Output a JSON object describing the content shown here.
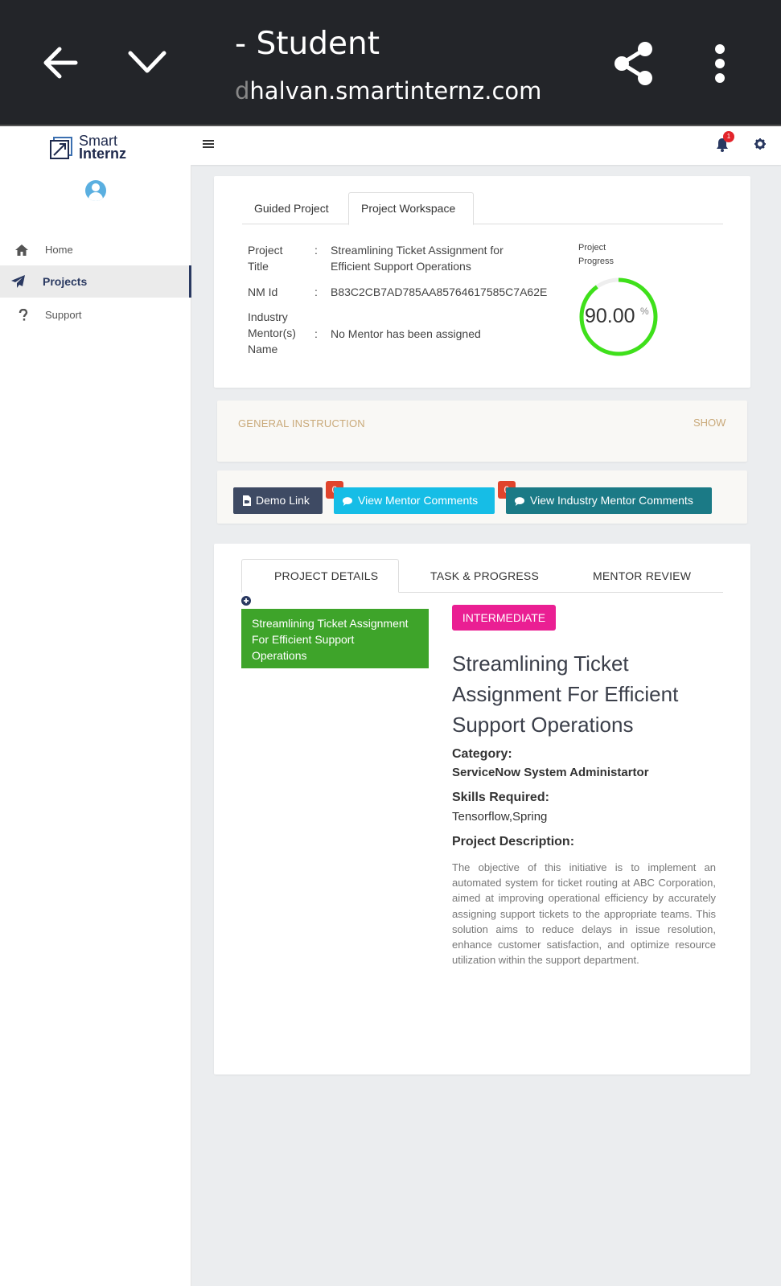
{
  "browser": {
    "title": "- Student",
    "url_faded": "d",
    "url": "halvan.smartinternz.com"
  },
  "header": {
    "logo_line1": "Smart",
    "logo_line2": "Internz",
    "notification_count": "1"
  },
  "sidebar": {
    "items": [
      {
        "label": "Home",
        "icon": "home-icon"
      },
      {
        "label": "Projects",
        "icon": "paper-plane-icon"
      },
      {
        "label": "Support",
        "icon": "question-icon"
      }
    ]
  },
  "top_tabs": [
    "Guided Project",
    "Project Workspace"
  ],
  "project_info": {
    "title_label_1": "Project",
    "title_label_2": "Title",
    "title_value_1": "Streamlining Ticket Assignment for",
    "title_value_2": "Efficient Support Operations",
    "nm_label": "NM Id",
    "nm_value": "B83C2CB7AD785AA85764617585C7A62E",
    "mentor_label_1": "Industry",
    "mentor_label_2": "Mentor(s)",
    "mentor_label_3": "Name",
    "mentor_value": "No Mentor has been assigned",
    "colon": ":"
  },
  "progress": {
    "label_1": "Project",
    "label_2": "Progress",
    "value": "90.00",
    "unit": "%",
    "fraction": 0.9
  },
  "general_instruction": {
    "title": "GENERAL INSTRUCTION",
    "toggle": "SHOW"
  },
  "actions": {
    "demo": "Demo Link",
    "mentor_comments": "View Mentor Comments",
    "mentor_comments_count": "0",
    "industry_comments": "View Industry Mentor Comments",
    "industry_comments_count": "0"
  },
  "detail_tabs": [
    "PROJECT DETAILS",
    "TASK & PROGRESS",
    "MENTOR REVIEW"
  ],
  "project_list": {
    "item_line1": "Streamlining Ticket Assignment",
    "item_line2": "For Efficient Support",
    "item_line3": "Operations"
  },
  "project_detail": {
    "level": "INTERMEDIATE",
    "heading_1": "Streamlining Ticket",
    "heading_2": "Assignment For Efficient",
    "heading_3": "Support Operations",
    "category_label": "Category:",
    "category_value": "ServiceNow System Administartor",
    "skills_label": "Skills Required:",
    "skills_value": "Tensorflow,Spring",
    "description_label": "Project Description:",
    "description": "The objective of this initiative is to implement an automated system for ticket routing at ABC Corporation, aimed at improving operational efficiency by accurately assigning support tickets to the appropriate teams. This solution aims to reduce delays in issue resolution, enhance customer satisfaction, and optimize resource utilization within the support department."
  },
  "colors": {
    "browser_bar": "#232529",
    "accent_navy": "#2a3961",
    "progress_green": "#3fe01b",
    "level_pink": "#ea1f93",
    "item_green": "#3ea42a",
    "instruction_gold": "#c9a979"
  }
}
